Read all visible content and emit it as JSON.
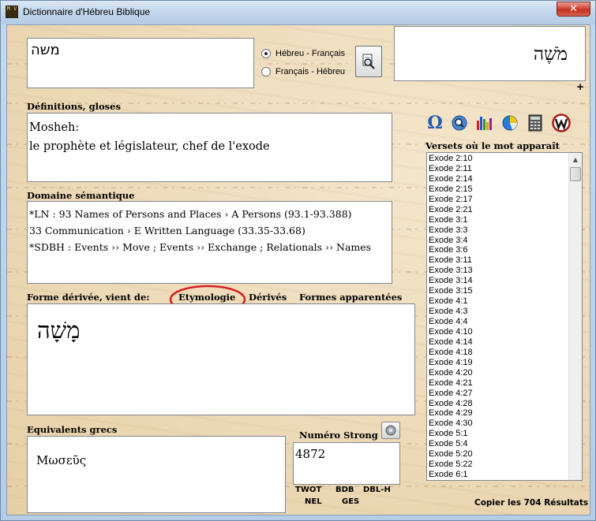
{
  "window": {
    "title": "Dictionnaire d'Hébreu Biblique",
    "close_glyph": "✕",
    "app_icon_text": "M V"
  },
  "search": {
    "input_value": "משה",
    "direction_options": [
      {
        "label": "Hébreu - Français",
        "selected": true
      },
      {
        "label": "Français - Hébreu",
        "selected": false
      }
    ],
    "search_icon": "magnifier-document-icon"
  },
  "preview": {
    "word": "מֹשֶׁה",
    "plus": "+"
  },
  "definitions": {
    "label": "Définitions, gloses",
    "lines": [
      "Mosheh:",
      "le prophète et législateur, chef de l'exode"
    ]
  },
  "semantic_domain": {
    "label": "Domaine sémantique",
    "lines": [
      "*LN : 93 Names of Persons and Places › A Persons (93.1-93.388)",
      "33 Communication › E Written Language (33.35-33.68)",
      "*SDBH : Events ›› Move ; Events ›› Exchange ; Relationals ›› Names"
    ]
  },
  "derived": {
    "label": "Forme dérivée, vient de:",
    "tabs": [
      "Etymologie",
      "Dérivés",
      "Formes apparentées"
    ],
    "word": "מָשָׁה"
  },
  "greek": {
    "label": "Equivalents grecs",
    "value": "Μωσεῦς"
  },
  "strong": {
    "label": "Numéro Strong",
    "value": "4872",
    "links_row1": [
      "TWOT",
      "BDB",
      "DBL-H"
    ],
    "links_row2": [
      "NEL",
      "GES"
    ]
  },
  "toolbar": {
    "icons": [
      "omega-icon",
      "search-globe-icon",
      "bar-chart-icon",
      "pie-chart-icon",
      "calculator-icon",
      "w-logo-icon"
    ],
    "colors": {
      "omega": "#1f5fb0",
      "accent_red": "#d62020"
    }
  },
  "verses": {
    "label": "Versets où le mot apparaît",
    "items": [
      "Exode 2:10",
      "Exode 2:11",
      "Exode 2:14",
      "Exode 2:15",
      "Exode 2:17",
      "Exode 2:21",
      "Exode 3:1",
      "Exode 3:3",
      "Exode 3:4",
      "Exode 3:6",
      "Exode 3:11",
      "Exode 3:13",
      "Exode 3:14",
      "Exode 3:15",
      "Exode 4:1",
      "Exode 4:3",
      "Exode 4:4",
      "Exode 4:10",
      "Exode 4:14",
      "Exode 4:18",
      "Exode 4:19",
      "Exode 4:20",
      "Exode 4:21",
      "Exode 4:27",
      "Exode 4:28",
      "Exode 4:29",
      "Exode 4:30",
      "Exode 5:1",
      "Exode 5:4",
      "Exode 5:20",
      "Exode 5:22",
      "Exode 6:1"
    ],
    "copy_label": "Copier les 704 Résultats"
  }
}
